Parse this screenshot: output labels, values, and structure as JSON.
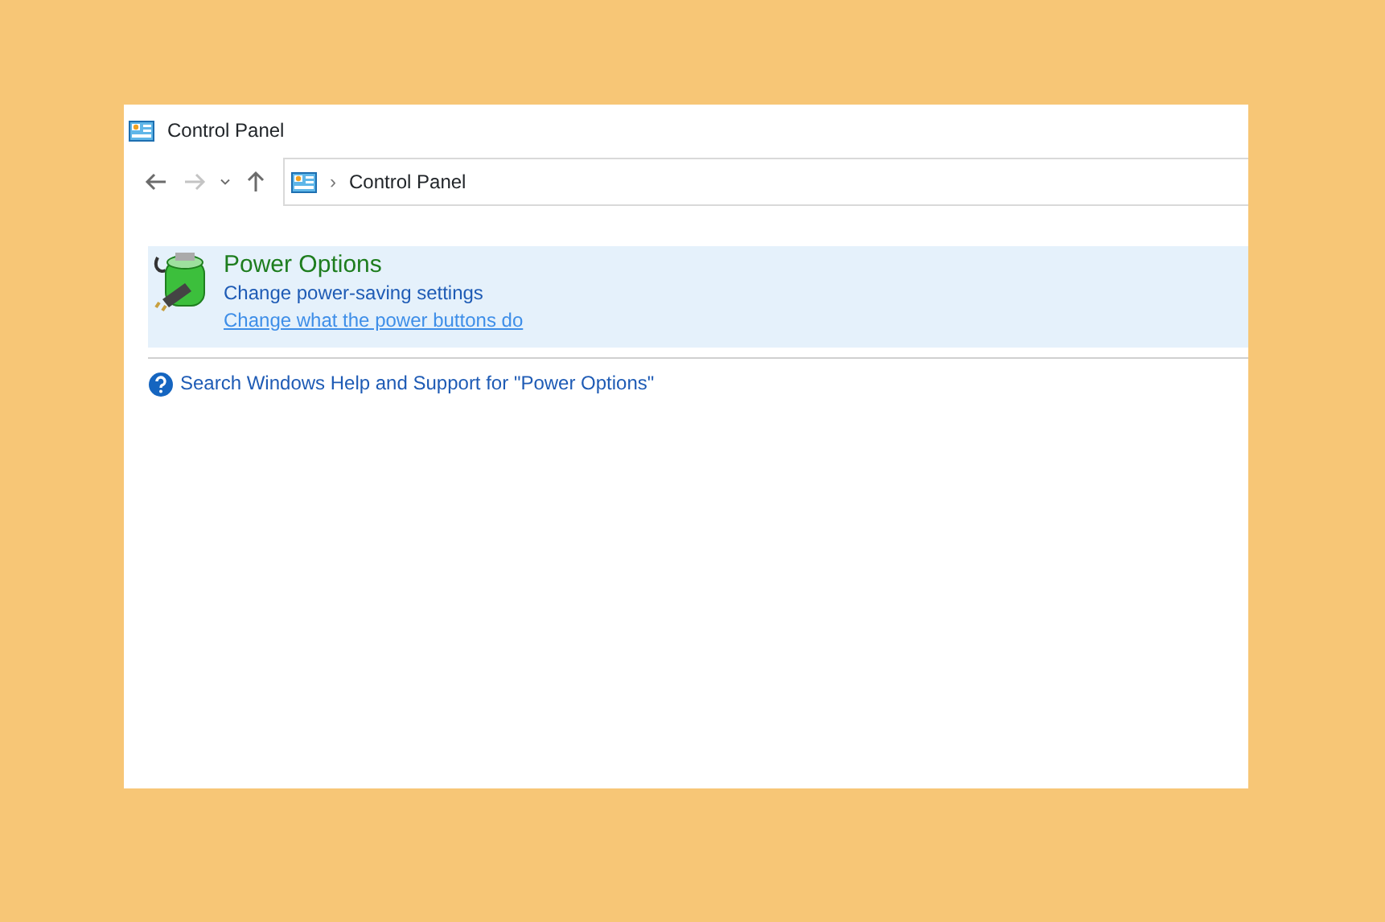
{
  "window": {
    "title": "Control Panel"
  },
  "nav_buttons": [
    {
      "kind": "back",
      "disabled": false
    },
    {
      "kind": "forward",
      "disabled": true
    },
    {
      "kind": "recent",
      "disabled": false
    },
    {
      "kind": "up",
      "disabled": false
    }
  ],
  "address_bar": {
    "separator": "›",
    "path": "Control Panel"
  },
  "result": {
    "title": "Power Options",
    "links": [
      {
        "label": "Change power-saving settings",
        "hovered": false
      },
      {
        "label": "Change what the power buttons do",
        "hovered": true
      }
    ]
  },
  "help_link": "Search Windows Help and Support for \"Power Options\""
}
